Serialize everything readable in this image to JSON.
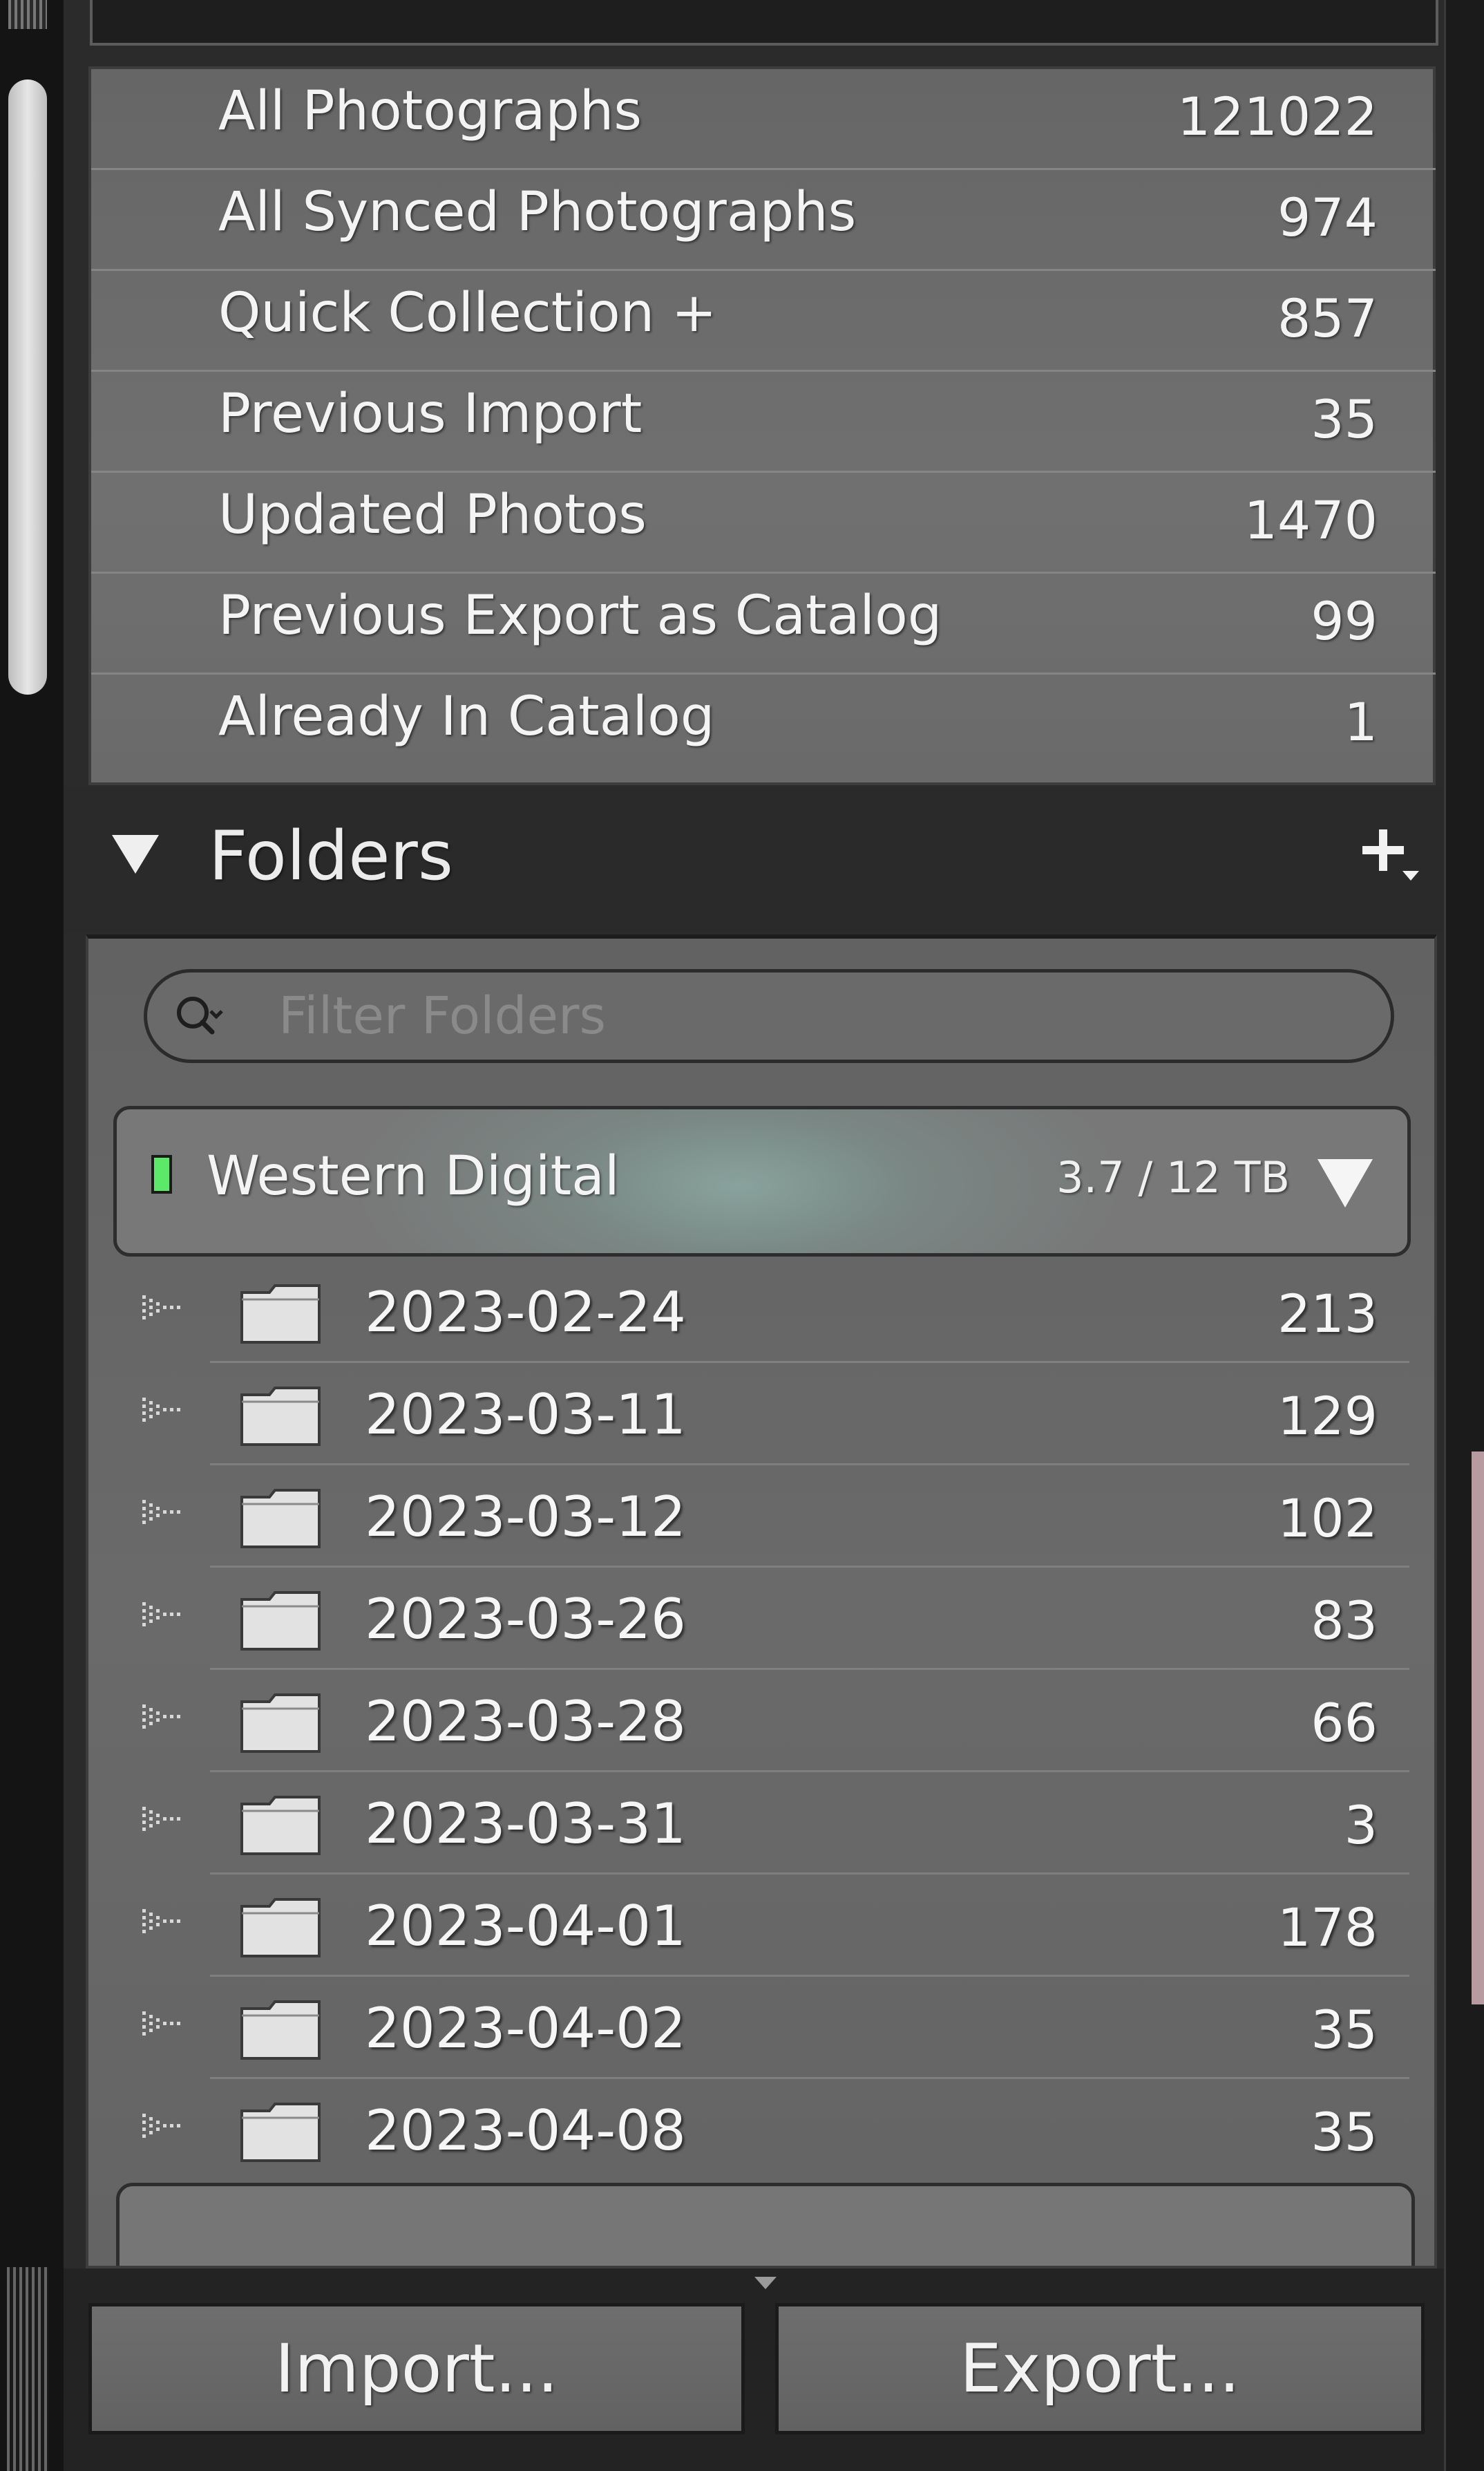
{
  "collections": [
    {
      "label": "All Photographs",
      "count": "121022"
    },
    {
      "label": "All Synced Photographs",
      "count": "974"
    },
    {
      "label": "Quick Collection +",
      "count": "857"
    },
    {
      "label": "Previous Import",
      "count": "35"
    },
    {
      "label": "Updated Photos",
      "count": "1470"
    },
    {
      "label": "Previous Export as Catalog",
      "count": "99"
    },
    {
      "label": "Already In Catalog",
      "count": "1"
    }
  ],
  "folders": {
    "title": "Folders",
    "filter_placeholder": "Filter Folders",
    "volume": {
      "name": "Western Digital",
      "usage": "3.7 / 12 TB",
      "status_color": "#5ee86a"
    },
    "items": [
      {
        "name": "2023-02-24",
        "count": "213"
      },
      {
        "name": "2023-03-11",
        "count": "129"
      },
      {
        "name": "2023-03-12",
        "count": "102"
      },
      {
        "name": "2023-03-26",
        "count": "83"
      },
      {
        "name": "2023-03-28",
        "count": "66"
      },
      {
        "name": "2023-03-31",
        "count": "3"
      },
      {
        "name": "2023-04-01",
        "count": "178"
      },
      {
        "name": "2023-04-02",
        "count": "35"
      },
      {
        "name": "2023-04-08",
        "count": "35"
      }
    ]
  },
  "buttons": {
    "import": "Import...",
    "export": "Export..."
  },
  "icons": {
    "section_toggle": "disclosure-triangle-icon",
    "add_folder": "plus-dropdown-icon",
    "search": "search-icon",
    "folder": "folder-icon",
    "expand": "disclosure-dots-icon"
  }
}
